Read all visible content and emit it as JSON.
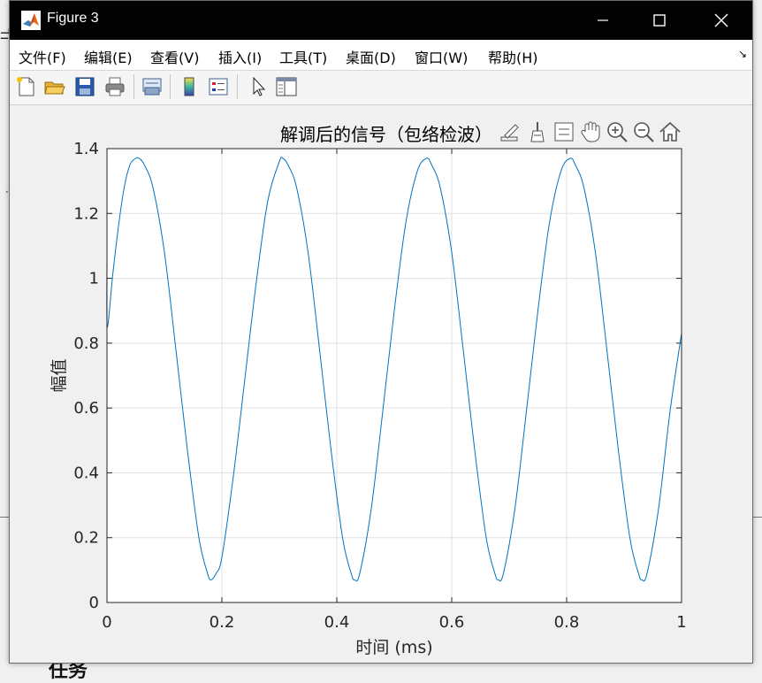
{
  "background": {
    "left_fragment": "弌",
    "dot": "·",
    "bottom_fragment": "任务"
  },
  "window": {
    "title": "Figure 3",
    "icons": {
      "app": "matlab-logo-icon",
      "minimize": "minimize-icon",
      "maximize": "maximize-icon",
      "close": "close-icon"
    }
  },
  "menu": {
    "items": [
      "文件(F)",
      "编辑(E)",
      "查看(V)",
      "插入(I)",
      "工具(T)",
      "桌面(D)",
      "窗口(W)",
      "帮助(H)"
    ],
    "overflow_icon": "↘"
  },
  "toolbar": {
    "buttons": [
      "new-figure-icon",
      "open-file-icon",
      "save-icon",
      "print-icon",
      "link-plot-icon",
      "colorbar-icon",
      "legend-icon",
      "edit-plot-pointer-icon",
      "property-inspector-icon"
    ]
  },
  "axes_toolbar": {
    "buttons": [
      "export-icon",
      "brush-icon",
      "data-tips-icon",
      "pan-hand-icon",
      "zoom-in-icon",
      "zoom-out-icon",
      "home-icon"
    ]
  },
  "colors": {
    "line": "#0072bd",
    "titlebar": "#020202",
    "grid": "#e0e0e0"
  },
  "chart_data": {
    "type": "line",
    "title": "解调后的信号（包络检波）",
    "xlabel": "时间 (ms)",
    "ylabel": "幅值",
    "xlim": [
      0,
      1
    ],
    "ylim": [
      0,
      1.4
    ],
    "xticks": [
      "0",
      "0.2",
      "0.4",
      "0.6",
      "0.8",
      "1"
    ],
    "xtick_values": [
      0,
      0.2,
      0.4,
      0.6,
      0.8,
      1
    ],
    "yticks": [
      "0",
      "0.2",
      "0.4",
      "0.6",
      "0.8",
      "1",
      "1.2",
      "1.4"
    ],
    "ytick_values": [
      0,
      0.2,
      0.4,
      0.6,
      0.8,
      1,
      1.2,
      1.4
    ],
    "grid": true,
    "series": [
      {
        "x": [
          0,
          0.0005,
          0.01,
          0.02,
          0.03,
          0.04,
          0.05,
          0.056,
          0.065,
          0.08,
          0.1,
          0.12,
          0.14,
          0.16,
          0.175,
          0.181,
          0.19,
          0.2,
          0.22,
          0.24,
          0.26,
          0.28,
          0.3,
          0.306,
          0.315,
          0.33,
          0.35,
          0.37,
          0.39,
          0.41,
          0.425,
          0.431,
          0.44,
          0.46,
          0.48,
          0.5,
          0.52,
          0.54,
          0.556,
          0.565,
          0.58,
          0.6,
          0.62,
          0.64,
          0.66,
          0.675,
          0.681,
          0.69,
          0.71,
          0.73,
          0.75,
          0.77,
          0.79,
          0.806,
          0.815,
          0.83,
          0.85,
          0.87,
          0.89,
          0.91,
          0.925,
          0.931,
          0.94,
          0.96,
          0.98,
          1.0
        ],
        "y": [
          1.06,
          0.85,
          1.01,
          1.16,
          1.28,
          1.35,
          1.37,
          1.37,
          1.35,
          1.28,
          1.08,
          0.78,
          0.47,
          0.2,
          0.09,
          0.07,
          0.09,
          0.14,
          0.39,
          0.69,
          0.99,
          1.24,
          1.36,
          1.37,
          1.35,
          1.28,
          1.08,
          0.78,
          0.47,
          0.2,
          0.09,
          0.07,
          0.09,
          0.29,
          0.59,
          0.9,
          1.17,
          1.33,
          1.37,
          1.35,
          1.28,
          1.08,
          0.78,
          0.47,
          0.2,
          0.09,
          0.07,
          0.09,
          0.29,
          0.59,
          0.9,
          1.17,
          1.33,
          1.37,
          1.35,
          1.28,
          1.08,
          0.78,
          0.47,
          0.2,
          0.09,
          0.07,
          0.09,
          0.29,
          0.59,
          0.83
        ]
      }
    ]
  }
}
